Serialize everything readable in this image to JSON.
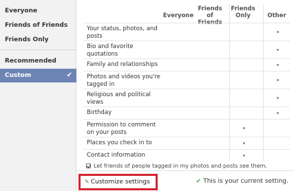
{
  "sidebar": {
    "items": [
      {
        "label": "Everyone"
      },
      {
        "label": "Friends of Friends"
      },
      {
        "label": "Friends Only"
      },
      {
        "label": "Recommended"
      },
      {
        "label": "Custom"
      }
    ]
  },
  "table": {
    "columns": [
      "Everyone",
      "Friends of Friends",
      "Friends Only",
      "Other"
    ],
    "rows": [
      {
        "label": "Your status, photos, and posts",
        "setting": "Other"
      },
      {
        "label": "Bio and favorite quotations",
        "setting": "Other"
      },
      {
        "label": "Family and relationships",
        "setting": "Other"
      },
      {
        "label": "Photos and videos you're tagged in",
        "setting": "Other"
      },
      {
        "label": "Religious and political views",
        "setting": "Other"
      },
      {
        "label": "Birthday",
        "setting": "Other"
      },
      {
        "label": "Permission to comment on your posts",
        "setting": "Friends Only"
      },
      {
        "label": "Places you check in to",
        "setting": "Friends Only"
      },
      {
        "label": "Contact information",
        "setting": "Friends Only"
      }
    ]
  },
  "note": {
    "text": "Let friends of people tagged in my photos and posts see them.",
    "checked": true
  },
  "footer": {
    "customize_label": "Customize settings",
    "current_label": "This is your current setting."
  }
}
